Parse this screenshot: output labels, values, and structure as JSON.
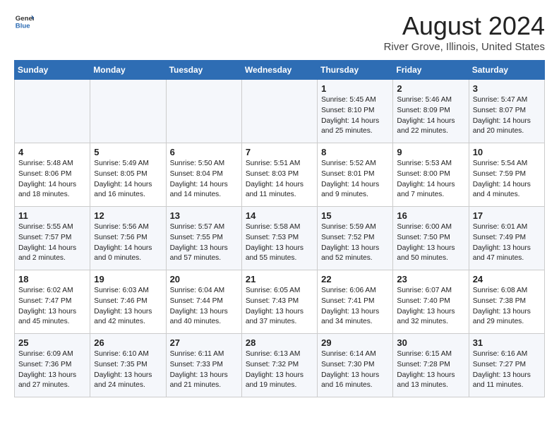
{
  "header": {
    "logo_general": "General",
    "logo_blue": "Blue",
    "title": "August 2024",
    "subtitle": "River Grove, Illinois, United States"
  },
  "days_of_week": [
    "Sunday",
    "Monday",
    "Tuesday",
    "Wednesday",
    "Thursday",
    "Friday",
    "Saturday"
  ],
  "weeks": [
    [
      {
        "day": "",
        "info": ""
      },
      {
        "day": "",
        "info": ""
      },
      {
        "day": "",
        "info": ""
      },
      {
        "day": "",
        "info": ""
      },
      {
        "day": "1",
        "info": "Sunrise: 5:45 AM\nSunset: 8:10 PM\nDaylight: 14 hours\nand 25 minutes."
      },
      {
        "day": "2",
        "info": "Sunrise: 5:46 AM\nSunset: 8:09 PM\nDaylight: 14 hours\nand 22 minutes."
      },
      {
        "day": "3",
        "info": "Sunrise: 5:47 AM\nSunset: 8:07 PM\nDaylight: 14 hours\nand 20 minutes."
      }
    ],
    [
      {
        "day": "4",
        "info": "Sunrise: 5:48 AM\nSunset: 8:06 PM\nDaylight: 14 hours\nand 18 minutes."
      },
      {
        "day": "5",
        "info": "Sunrise: 5:49 AM\nSunset: 8:05 PM\nDaylight: 14 hours\nand 16 minutes."
      },
      {
        "day": "6",
        "info": "Sunrise: 5:50 AM\nSunset: 8:04 PM\nDaylight: 14 hours\nand 14 minutes."
      },
      {
        "day": "7",
        "info": "Sunrise: 5:51 AM\nSunset: 8:03 PM\nDaylight: 14 hours\nand 11 minutes."
      },
      {
        "day": "8",
        "info": "Sunrise: 5:52 AM\nSunset: 8:01 PM\nDaylight: 14 hours\nand 9 minutes."
      },
      {
        "day": "9",
        "info": "Sunrise: 5:53 AM\nSunset: 8:00 PM\nDaylight: 14 hours\nand 7 minutes."
      },
      {
        "day": "10",
        "info": "Sunrise: 5:54 AM\nSunset: 7:59 PM\nDaylight: 14 hours\nand 4 minutes."
      }
    ],
    [
      {
        "day": "11",
        "info": "Sunrise: 5:55 AM\nSunset: 7:57 PM\nDaylight: 14 hours\nand 2 minutes."
      },
      {
        "day": "12",
        "info": "Sunrise: 5:56 AM\nSunset: 7:56 PM\nDaylight: 14 hours\nand 0 minutes."
      },
      {
        "day": "13",
        "info": "Sunrise: 5:57 AM\nSunset: 7:55 PM\nDaylight: 13 hours\nand 57 minutes."
      },
      {
        "day": "14",
        "info": "Sunrise: 5:58 AM\nSunset: 7:53 PM\nDaylight: 13 hours\nand 55 minutes."
      },
      {
        "day": "15",
        "info": "Sunrise: 5:59 AM\nSunset: 7:52 PM\nDaylight: 13 hours\nand 52 minutes."
      },
      {
        "day": "16",
        "info": "Sunrise: 6:00 AM\nSunset: 7:50 PM\nDaylight: 13 hours\nand 50 minutes."
      },
      {
        "day": "17",
        "info": "Sunrise: 6:01 AM\nSunset: 7:49 PM\nDaylight: 13 hours\nand 47 minutes."
      }
    ],
    [
      {
        "day": "18",
        "info": "Sunrise: 6:02 AM\nSunset: 7:47 PM\nDaylight: 13 hours\nand 45 minutes."
      },
      {
        "day": "19",
        "info": "Sunrise: 6:03 AM\nSunset: 7:46 PM\nDaylight: 13 hours\nand 42 minutes."
      },
      {
        "day": "20",
        "info": "Sunrise: 6:04 AM\nSunset: 7:44 PM\nDaylight: 13 hours\nand 40 minutes."
      },
      {
        "day": "21",
        "info": "Sunrise: 6:05 AM\nSunset: 7:43 PM\nDaylight: 13 hours\nand 37 minutes."
      },
      {
        "day": "22",
        "info": "Sunrise: 6:06 AM\nSunset: 7:41 PM\nDaylight: 13 hours\nand 34 minutes."
      },
      {
        "day": "23",
        "info": "Sunrise: 6:07 AM\nSunset: 7:40 PM\nDaylight: 13 hours\nand 32 minutes."
      },
      {
        "day": "24",
        "info": "Sunrise: 6:08 AM\nSunset: 7:38 PM\nDaylight: 13 hours\nand 29 minutes."
      }
    ],
    [
      {
        "day": "25",
        "info": "Sunrise: 6:09 AM\nSunset: 7:36 PM\nDaylight: 13 hours\nand 27 minutes."
      },
      {
        "day": "26",
        "info": "Sunrise: 6:10 AM\nSunset: 7:35 PM\nDaylight: 13 hours\nand 24 minutes."
      },
      {
        "day": "27",
        "info": "Sunrise: 6:11 AM\nSunset: 7:33 PM\nDaylight: 13 hours\nand 21 minutes."
      },
      {
        "day": "28",
        "info": "Sunrise: 6:13 AM\nSunset: 7:32 PM\nDaylight: 13 hours\nand 19 minutes."
      },
      {
        "day": "29",
        "info": "Sunrise: 6:14 AM\nSunset: 7:30 PM\nDaylight: 13 hours\nand 16 minutes."
      },
      {
        "day": "30",
        "info": "Sunrise: 6:15 AM\nSunset: 7:28 PM\nDaylight: 13 hours\nand 13 minutes."
      },
      {
        "day": "31",
        "info": "Sunrise: 6:16 AM\nSunset: 7:27 PM\nDaylight: 13 hours\nand 11 minutes."
      }
    ]
  ]
}
